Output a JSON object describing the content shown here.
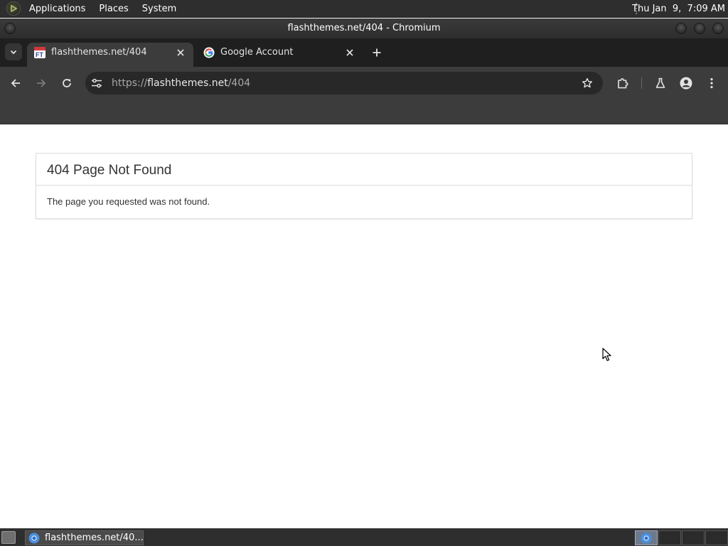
{
  "top_panel": {
    "menus": [
      "Applications",
      "Places",
      "System"
    ],
    "clock": "Thu Jan  9,  7:09 AM"
  },
  "window": {
    "title": "flashthemes.net/404 - Chromium"
  },
  "tabs": [
    {
      "title": "flashthemes.net/404",
      "favicon": "ft-logo-icon",
      "active": true
    },
    {
      "title": "Google Account",
      "favicon": "google-g-icon",
      "active": false
    }
  ],
  "omnibox": {
    "scheme": "https://",
    "host": "flashthemes.net",
    "path": "/404"
  },
  "page": {
    "heading": "404 Page Not Found",
    "body": "The page you requested was not found."
  },
  "taskbar": {
    "item_label": "flashthemes.net/40..."
  },
  "colors": {
    "panel_bg": "#2e2e2e",
    "tabstrip_bg": "#1f1f1f",
    "toolbar_bg": "#3c3c3c",
    "omnibox_bg": "#282828",
    "page_text": "#333333"
  }
}
